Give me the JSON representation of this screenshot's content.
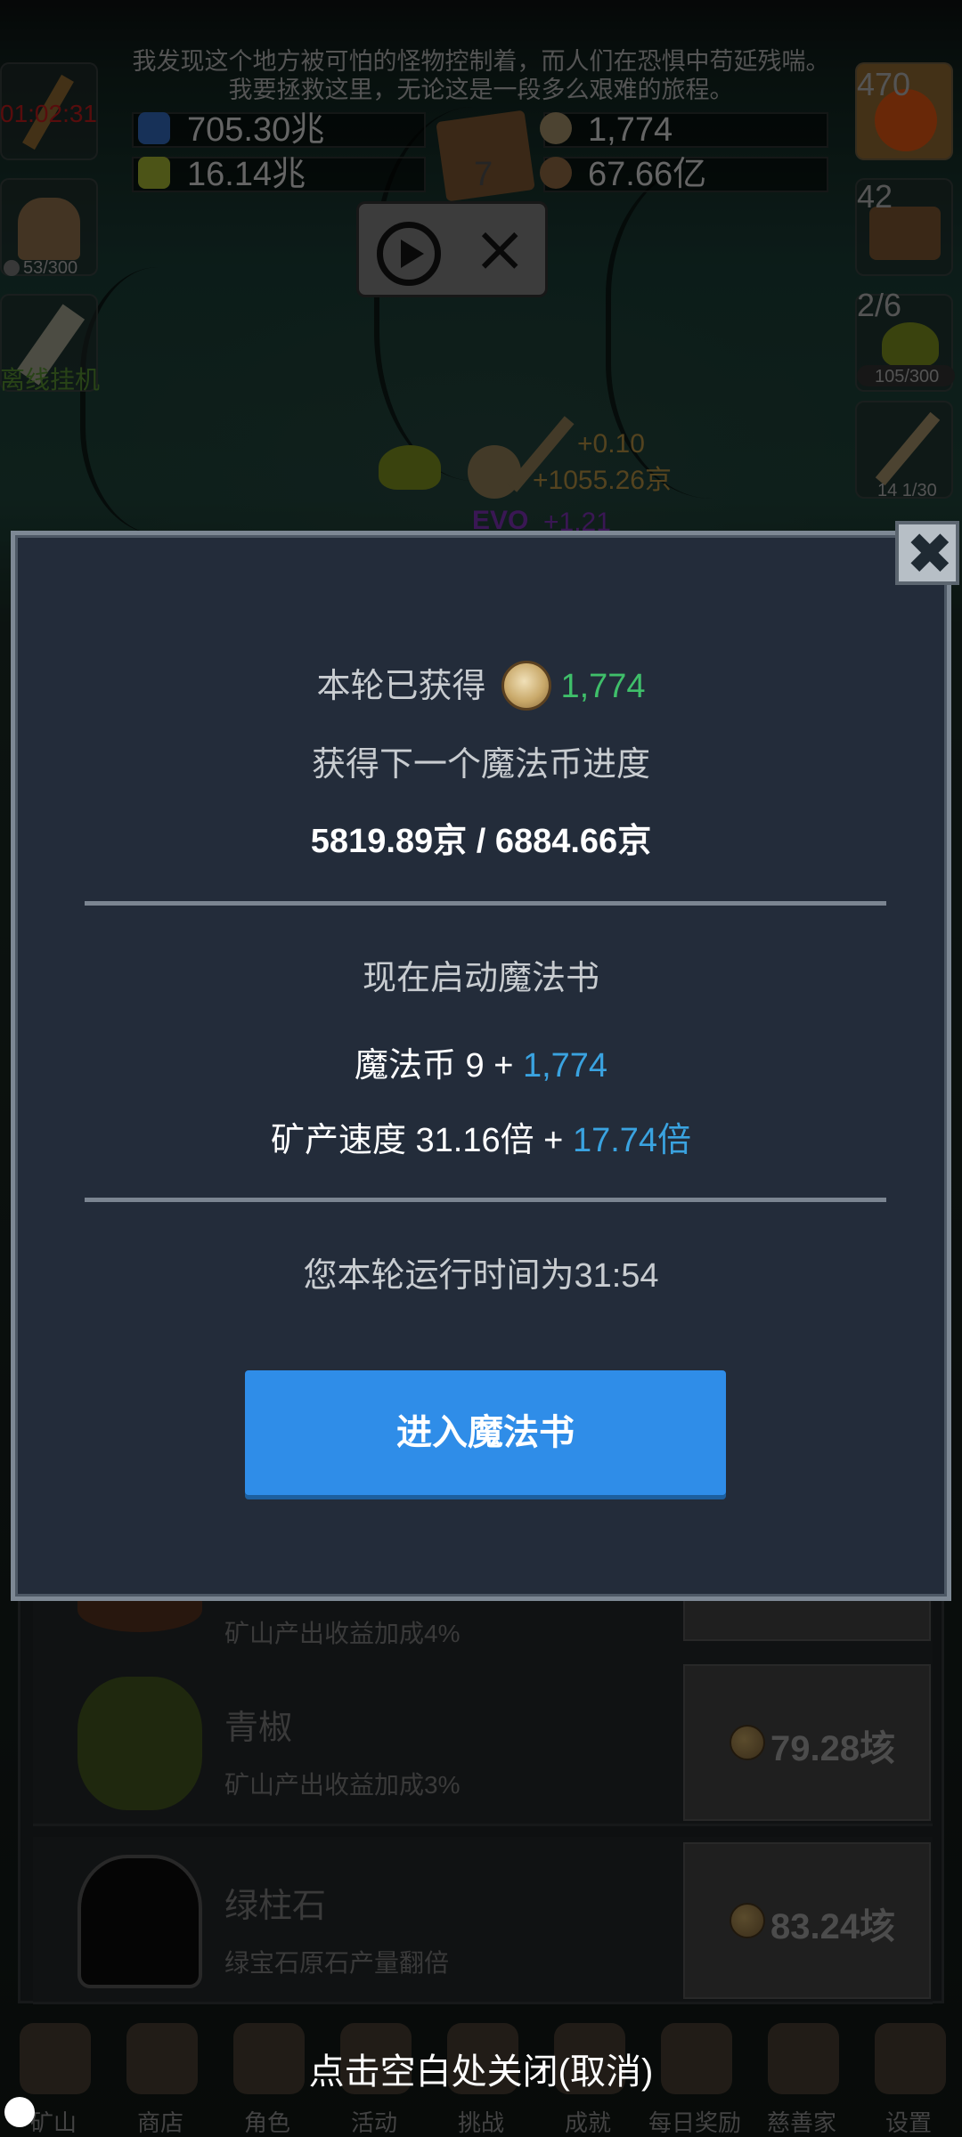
{
  "story": {
    "line1": "我发现这个地方被可怕的怪物控制着，而人们在恐惧中苟延残喘。",
    "line2": "我要拯救这里，无论这是一段多么艰难的旅程。"
  },
  "top_left": {
    "timer": "01:02:31",
    "torch_count": "53/300",
    "offline_label": "离线挂机"
  },
  "resources": {
    "blue_potion": "705.30兆",
    "yellow_potion": "16.14兆",
    "book_level": "7",
    "coins": "1,774",
    "ore": "67.66亿"
  },
  "right_side": {
    "potion_count": "470",
    "chest_count": "42",
    "slime_progress": "2/6",
    "slime_hp": "105/300",
    "sword_count": "14 1/30"
  },
  "floating": {
    "plus_small": "+0.10",
    "plus_big": "+1055.26京",
    "evo_label": "EVO",
    "evo_plus": "+1.21"
  },
  "modal": {
    "earned_label": "本轮已获得",
    "earned_value": "1,774",
    "next_coin_label": "获得下一个魔法币进度",
    "progress": "5819.89京 / 6884.66京",
    "start_label": "现在启动魔法书",
    "coin_label": "魔法币 9 + ",
    "coin_bonus": "1,774",
    "speed_label": "矿产速度 31.16倍 + ",
    "speed_bonus": "17.74倍",
    "runtime": "您本轮运行时间为31:54",
    "enter_button": "进入魔法书"
  },
  "list": [
    {
      "name": "",
      "desc": "矿山产出收益加成4%",
      "price": ""
    },
    {
      "name": "青椒",
      "desc": "矿山产出收益加成3%",
      "price": "79.28垓"
    },
    {
      "name": "绿柱石",
      "desc": "绿宝石原石产量翻倍",
      "price": "83.24垓"
    }
  ],
  "hint": "点击空白处关闭(取消)",
  "nav": [
    "矿山",
    "商店",
    "角色",
    "活动",
    "挑战",
    "成就",
    "每日奖励",
    "慈善家",
    "设置"
  ],
  "colors": {
    "modal_bg": "#232c3a",
    "button": "#2f8de8",
    "green": "#3fbf6a",
    "blue": "#3aa3e0"
  }
}
